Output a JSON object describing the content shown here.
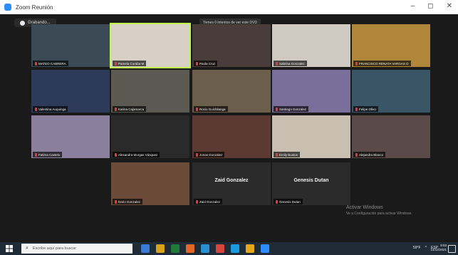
{
  "window": {
    "title": "Zoom Reunión",
    "minimize": "–",
    "maximize": "◻",
    "close": "✕"
  },
  "recording": {
    "label": "Grabando..."
  },
  "banner": {
    "text": "Tienes 0 intentos de ver este DVD"
  },
  "participants": [
    {
      "name": "MATEO CABRERA",
      "color": "#3c4a55"
    },
    {
      "name": "Pamela Curaba M",
      "color": "#d8d0c4",
      "active": true
    },
    {
      "name": "Paola Cruz",
      "color": "#4a3c3a"
    },
    {
      "name": "Sabrina Gonzalez",
      "color": "#cfcac2"
    },
    {
      "name": "FRANCISCO RENATA VARGAS O",
      "color": "#b0863a"
    },
    {
      "name": "Valentina Auquinga",
      "color": "#2e3a5a"
    },
    {
      "name": "Karina Cajamarca",
      "color": "#5a5a52"
    },
    {
      "name": "Rocio Guichilanga",
      "color": "#6b5e4a"
    },
    {
      "name": "Santiago Gonzalez",
      "color": "#7a6e9a"
    },
    {
      "name": "Felipe Olivo",
      "color": "#3a5566"
    },
    {
      "name": "Fatima Castelo",
      "color": "#8a7f9c"
    },
    {
      "name": "Alexandra Murgas Vásquez",
      "color": "#2a2a2a"
    },
    {
      "name": "Jonas Gonzalez",
      "color": "#5c3a33"
    },
    {
      "name": "Emily Bustos",
      "color": "#c9bfb1"
    },
    {
      "name": "Alejandra Blanco",
      "color": "#5a4a4a"
    },
    {
      "name": "Dario Gonzalez",
      "color": "#6b4a3a"
    },
    {
      "name": "Zaid Gonzalez",
      "color": "#2b2b2b",
      "center": "Zaid Gonzalez"
    },
    {
      "name": "Genesis Dutan",
      "color": "#2b2b2b",
      "center": "Genesis Dutan"
    }
  ],
  "watermark": {
    "line1": "Activar Windows",
    "line2": "Ve a Configuración para activar Windows."
  },
  "taskbar": {
    "search_placeholder": "Escribe aquí para buscar",
    "app_icons": [
      "#3a7bd5",
      "#d9a21b",
      "#1f7a3a",
      "#e0662a",
      "#2a8fd1",
      "#d4463c",
      "#1a9be0",
      "#e6a71a",
      "#2d8cff"
    ],
    "weather": "59°F",
    "lang": "ESP",
    "time": "9:03",
    "date": "14/12/2021"
  }
}
